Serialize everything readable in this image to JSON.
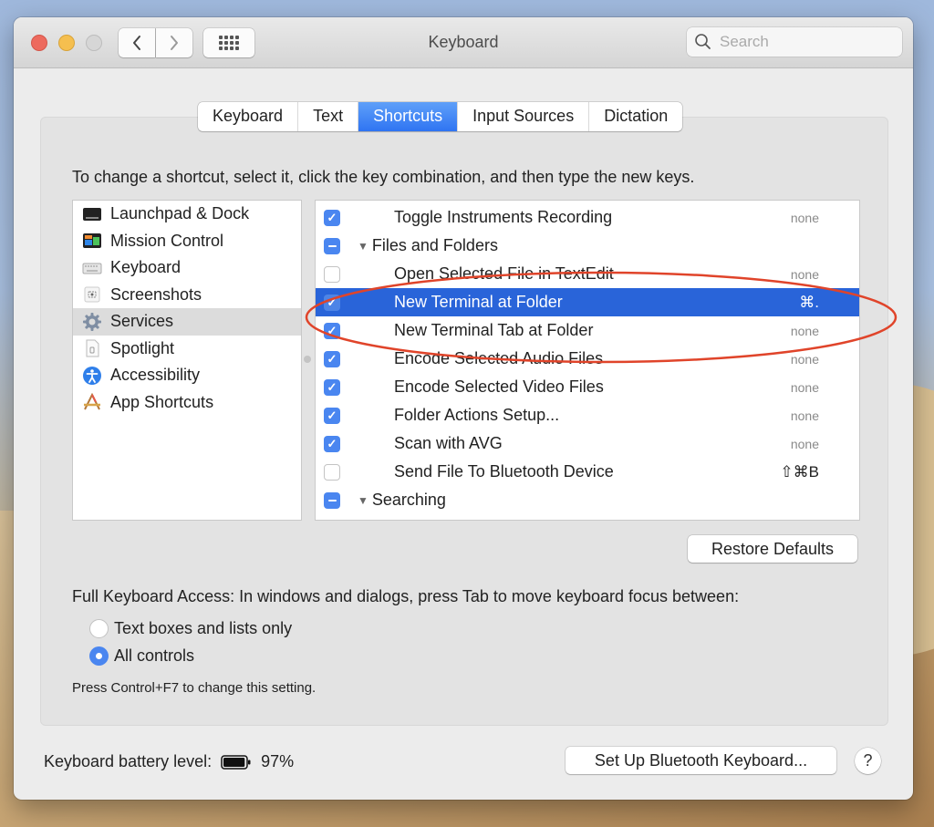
{
  "window": {
    "title": "Keyboard",
    "search_placeholder": "Search"
  },
  "tabs": [
    {
      "label": "Keyboard",
      "active": false
    },
    {
      "label": "Text",
      "active": false
    },
    {
      "label": "Shortcuts",
      "active": true
    },
    {
      "label": "Input Sources",
      "active": false
    },
    {
      "label": "Dictation",
      "active": false
    }
  ],
  "instructions": "To change a shortcut, select it, click the key combination, and then type the new keys.",
  "categories": [
    {
      "label": "Launchpad & Dock",
      "icon": "launchpad-dock-icon",
      "selected": false
    },
    {
      "label": "Mission Control",
      "icon": "mission-control-icon",
      "selected": false
    },
    {
      "label": "Keyboard",
      "icon": "keyboard-icon",
      "selected": false
    },
    {
      "label": "Screenshots",
      "icon": "screenshots-icon",
      "selected": false
    },
    {
      "label": "Services",
      "icon": "gear-icon",
      "selected": true
    },
    {
      "label": "Spotlight",
      "icon": "spotlight-icon",
      "selected": false
    },
    {
      "label": "Accessibility",
      "icon": "accessibility-icon",
      "selected": false
    },
    {
      "label": "App Shortcuts",
      "icon": "app-shortcuts-icon",
      "selected": false
    }
  ],
  "shortcuts": [
    {
      "type": "item",
      "label": "Toggle Instruments Recording",
      "checked": "on",
      "key": "none",
      "selected": false
    },
    {
      "type": "group",
      "label": "Files and Folders",
      "checked": "mixed"
    },
    {
      "type": "item",
      "label": "Open Selected File in TextEdit",
      "checked": "off",
      "key": "none",
      "selected": false
    },
    {
      "type": "item",
      "label": "New Terminal at Folder",
      "checked": "on",
      "key": "⌘.",
      "selected": true
    },
    {
      "type": "item",
      "label": "New Terminal Tab at Folder",
      "checked": "on",
      "key": "none",
      "selected": false
    },
    {
      "type": "item",
      "label": "Encode Selected Audio Files",
      "checked": "on",
      "key": "none",
      "selected": false
    },
    {
      "type": "item",
      "label": "Encode Selected Video Files",
      "checked": "on",
      "key": "none",
      "selected": false
    },
    {
      "type": "item",
      "label": "Folder Actions Setup...",
      "checked": "on",
      "key": "none",
      "selected": false
    },
    {
      "type": "item",
      "label": "Scan with AVG",
      "checked": "on",
      "key": "none",
      "selected": false
    },
    {
      "type": "item",
      "label": "Send File To Bluetooth Device",
      "checked": "off",
      "key": "⇧⌘B",
      "selected": false
    },
    {
      "type": "group",
      "label": "Searching",
      "checked": "mixed"
    }
  ],
  "buttons": {
    "restore_defaults": "Restore Defaults",
    "setup_bluetooth": "Set Up Bluetooth Keyboard...",
    "help": "?"
  },
  "full_keyboard_access": {
    "label": "Full Keyboard Access: In windows and dialogs, press Tab to move keyboard focus between:",
    "options": [
      {
        "label": "Text boxes and lists only",
        "selected": false
      },
      {
        "label": "All controls",
        "selected": true
      }
    ],
    "hint": "Press Control+F7 to change this setting."
  },
  "battery": {
    "label": "Keyboard battery level:",
    "value": "97%",
    "level": 0.97
  },
  "colors": {
    "accent": "#2f74f2",
    "selection": "#2964d9",
    "annotation": "#e0442a"
  }
}
